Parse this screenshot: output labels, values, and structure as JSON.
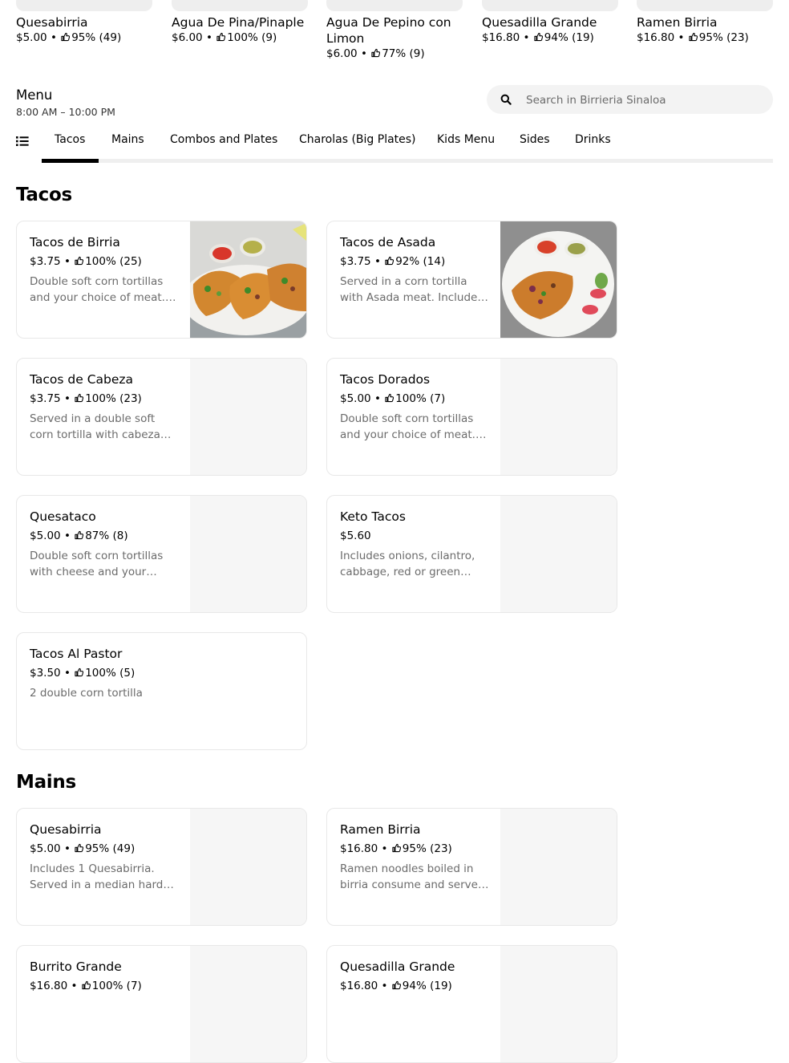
{
  "featured": [
    {
      "name": "Quesabirria",
      "price": "$5.00",
      "rating": "95% (49)"
    },
    {
      "name": "Agua De Pina/Pinaple",
      "price": "$6.00",
      "rating": "100% (9)"
    },
    {
      "name": "Agua De Pepino con Limon",
      "price": "$6.00",
      "rating": "77% (9)"
    },
    {
      "name": "Quesadilla Grande",
      "price": "$16.80",
      "rating": "94% (19)"
    },
    {
      "name": "Ramen Birria",
      "price": "$16.80",
      "rating": "95% (23)"
    }
  ],
  "menu": {
    "title": "Menu",
    "hours": "8:00 AM – 10:00 PM"
  },
  "search": {
    "placeholder": "Search in Birrieria Sinaloa",
    "value": ""
  },
  "tabs": [
    {
      "label": "Tacos",
      "active": true
    },
    {
      "label": "Mains"
    },
    {
      "label": "Combos and Plates"
    },
    {
      "label": "Charolas (Big Plates)"
    },
    {
      "label": "Kids Menu"
    },
    {
      "label": "Sides"
    },
    {
      "label": "Drinks"
    }
  ],
  "sections": {
    "tacos": {
      "title": "Tacos",
      "items": [
        {
          "name": "Tacos de Birria",
          "price": "$3.75",
          "rating": "100% (25)",
          "description": "Double soft corn tortillas and your choice of meat. Includes onions, cilantro, salsa and lime."
        },
        {
          "name": "Tacos de Asada",
          "price": "$3.75",
          "rating": "92% (14)",
          "description": "Served in a corn tortilla with Asada meat. Includes onions, cilantro, salsa and lime."
        },
        {
          "name": "Tacos de Cabeza",
          "price": "$3.75",
          "rating": "100% (23)",
          "description": "Served in a double soft corn tortilla with cabeza meat. Includes onions and cilantro."
        },
        {
          "name": "Tacos Dorados",
          "price": "$5.00",
          "rating": "100% (7)",
          "description": "Double soft corn tortillas and your choice of meat. Fried crispy with salsa."
        },
        {
          "name": "Quesataco",
          "price": "$5.00",
          "rating": "87% (8)",
          "description": "Double soft corn tortillas with cheese and your choice of meat."
        },
        {
          "name": "Keto Tacos",
          "price": "$5.60",
          "rating": "",
          "description": "Includes onions, cilantro, cabbage, red or green sauce and lime."
        },
        {
          "name": "Tacos Al Pastor",
          "price": "$3.50",
          "rating": "100% (5)",
          "description": "2 double corn tortilla"
        }
      ]
    },
    "mains": {
      "title": "Mains",
      "items": [
        {
          "name": "Quesabirria",
          "price": "$5.00",
          "rating": "95% (49)",
          "description": "Includes 1 Quesabirria. Served in a median hard shell tortilla with cheese."
        },
        {
          "name": "Ramen Birria",
          "price": "$16.80",
          "rating": "95% (23)",
          "description": "Ramen noodles boiled in birria consume and served with meat."
        },
        {
          "name": "Burrito Grande",
          "price": "$16.80",
          "rating": "100% (7)",
          "description": ""
        },
        {
          "name": "Quesadilla Grande",
          "price": "$16.80",
          "rating": "94% (19)",
          "description": ""
        }
      ]
    }
  },
  "colors": {
    "text": "#000000",
    "muted": "#6b6b6b",
    "border": "#e8e8e8",
    "placeholder_bg": "#f6f6f6",
    "search_bg": "#f3f3f3"
  },
  "icons": {
    "rating": "thumbs-up-icon",
    "search": "search-icon",
    "category_list": "list-icon"
  }
}
